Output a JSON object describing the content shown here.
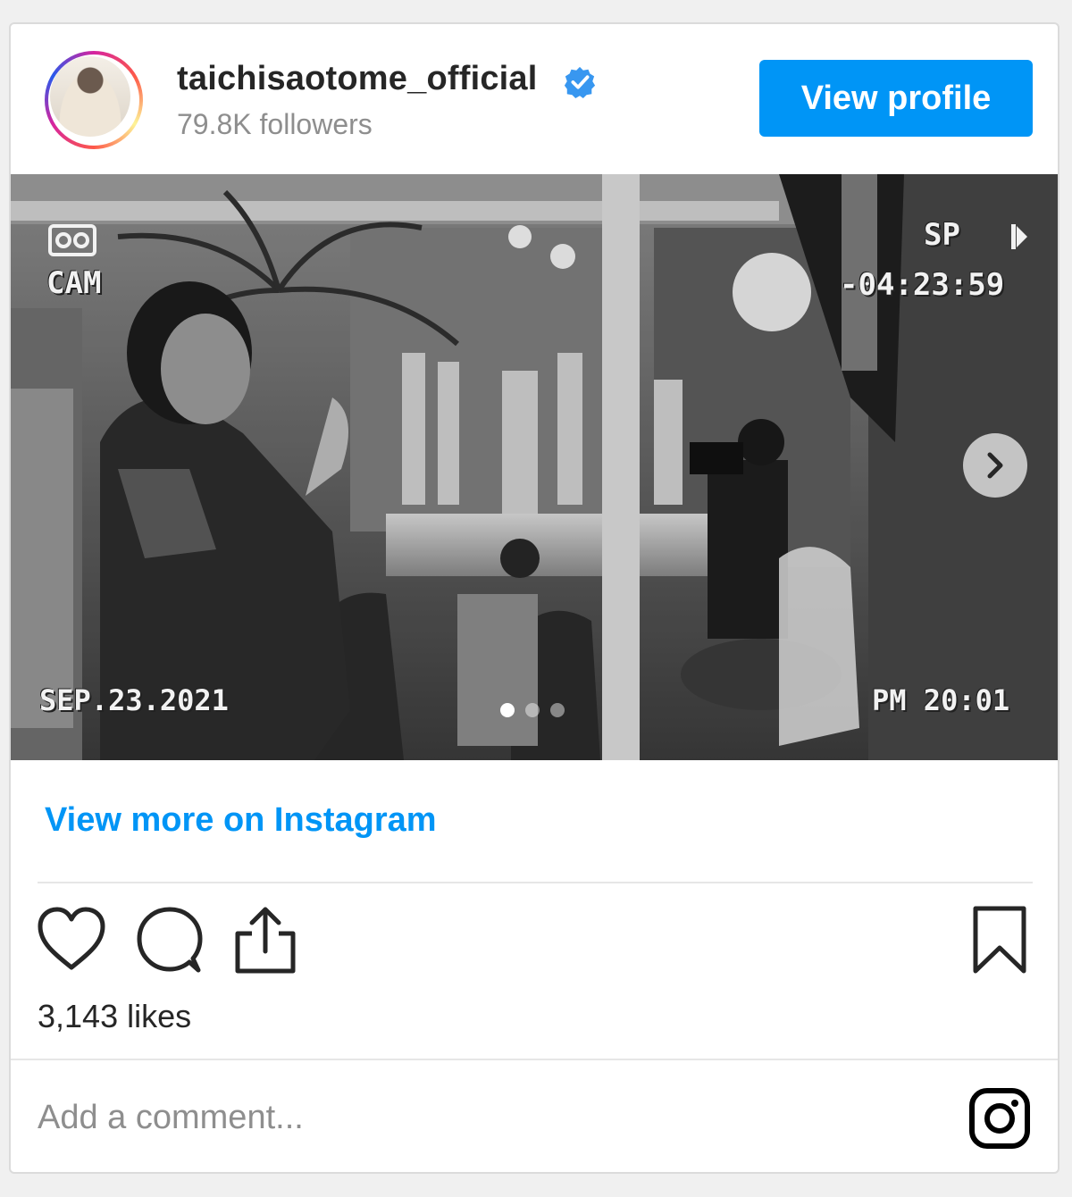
{
  "header": {
    "username": "taichisaotome_official",
    "followers": "79.8K followers",
    "view_profile_label": "View profile"
  },
  "media": {
    "overlay": {
      "cam": "CAM",
      "sp": "SP",
      "timecode": "-04:23:59",
      "date": "SEP.23.2021",
      "clock": "PM 20:01"
    },
    "carousel_count": 3,
    "carousel_active": 1
  },
  "footer": {
    "view_more": "View more on Instagram",
    "likes": "3,143 likes",
    "comment_placeholder": "Add a comment..."
  },
  "colors": {
    "accent": "#0095f6",
    "text": "#262626",
    "muted": "#8e8e8e"
  },
  "icons": [
    "verified-badge-icon",
    "camera-cam-icon",
    "play-icon",
    "chevron-right-icon",
    "heart-icon",
    "comment-icon",
    "share-icon",
    "bookmark-icon",
    "instagram-logo-icon"
  ]
}
